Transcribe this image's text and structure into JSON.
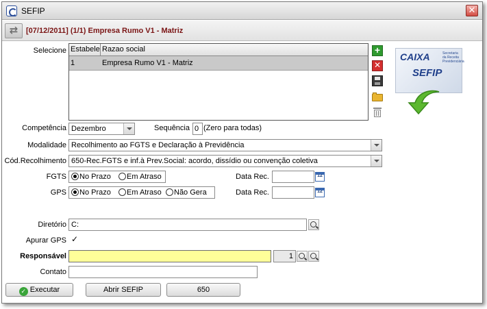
{
  "window": {
    "title": "SEFIP",
    "close_label": "✕"
  },
  "header": {
    "text": "[07/12/2011] (1/1) Empresa Rumo V1 - Matriz"
  },
  "selecione": {
    "label": "Selecione",
    "columns": [
      "Estabelec",
      "Razao social"
    ],
    "rows": [
      {
        "code": "1",
        "name": "Empresa Rumo V1 - Matriz",
        "selected": true
      }
    ]
  },
  "competencia": {
    "label": "Competência",
    "value": "Dezembro"
  },
  "sequencia": {
    "label": "Sequência",
    "value": "0",
    "hint": "(Zero para todas)"
  },
  "modalidade": {
    "label": "Modalidade",
    "value": "Recolhimento ao FGTS e Declaração à Previdência"
  },
  "cod_recolhimento": {
    "label": "Cód.Recolhimento",
    "value": "650-Rec.FGTS e inf.à Prev.Social: acordo, dissídio ou convenção coletiva"
  },
  "fgts": {
    "label": "FGTS",
    "options": [
      "No Prazo",
      "Em Atraso"
    ],
    "selected": 0,
    "data_rec_label": "Data Rec.",
    "data_rec_value": ""
  },
  "gps": {
    "label": "GPS",
    "options": [
      "No Prazo",
      "Em Atraso",
      "Não Gera"
    ],
    "selected": 0,
    "data_rec_label": "Data Rec.",
    "data_rec_value": ""
  },
  "diretorio": {
    "label": "Diretório",
    "value": "C:"
  },
  "apurar_gps": {
    "label": "Apurar GPS",
    "checked": true,
    "mark": "✓"
  },
  "responsavel": {
    "label": "Responsável",
    "value": "",
    "code": "1"
  },
  "contato": {
    "label": "Contato",
    "value": ""
  },
  "logo": {
    "brand": "CAIXA",
    "product": "SEFIP",
    "tagline": "Secretaria da Receita Previdenciária"
  },
  "calendar_icon_text": "12",
  "buttons": {
    "executar": "Executar",
    "abrir_sefip": "Abrir SEFIP",
    "code": "650"
  },
  "colors": {
    "header_text": "#7a1414",
    "selected_row": "#c9c9c9",
    "responsavel_bg": "#ffff99",
    "add": "#2f9a2f",
    "delete": "#d42f2f",
    "arrow": "#5cb82f"
  }
}
